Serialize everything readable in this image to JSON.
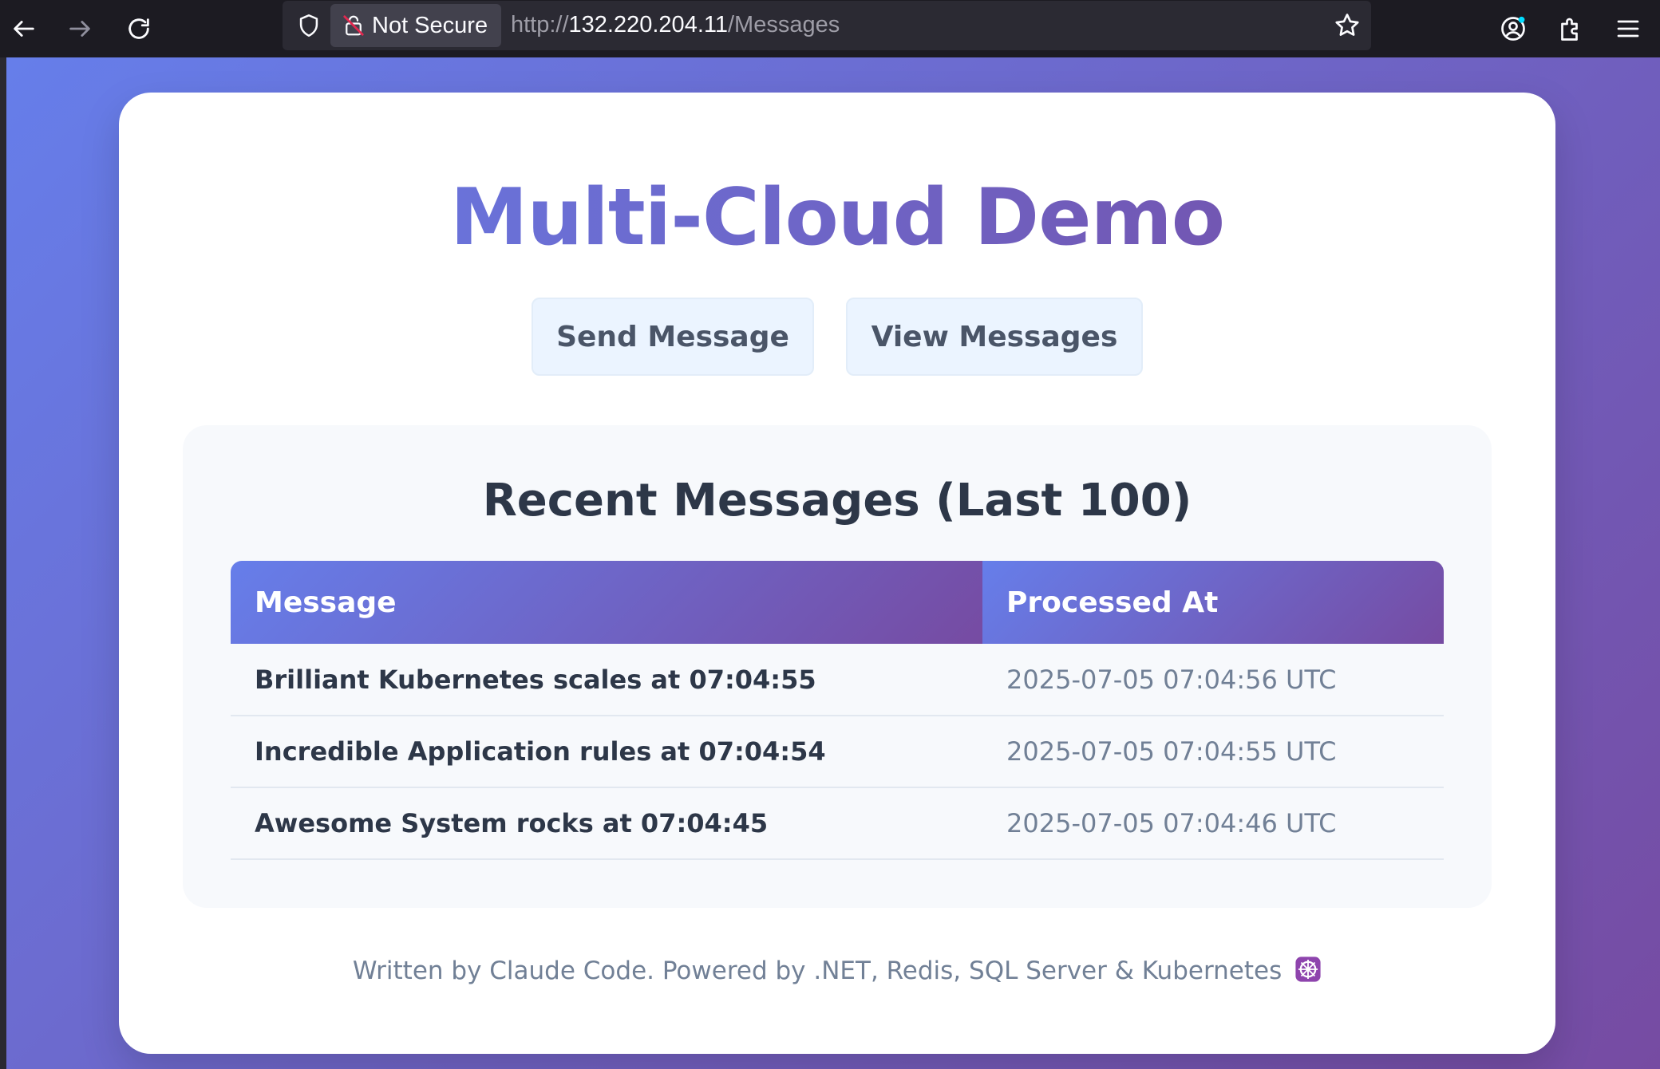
{
  "browser": {
    "security_label": "Not Secure",
    "url_scheme": "http://",
    "url_host": "132.220.204.11",
    "url_path": "/Messages"
  },
  "page": {
    "title": "Multi-Cloud Demo",
    "buttons": {
      "send": "Send Message",
      "view": "View Messages"
    },
    "messages_panel": {
      "title": "Recent Messages (Last 100)",
      "columns": [
        "Message",
        "Processed At"
      ],
      "rows": [
        {
          "message": "Brilliant Kubernetes scales at 07:04:55",
          "processed_at": "2025-07-05 07:04:56 UTC"
        },
        {
          "message": "Incredible Application rules at 07:04:54",
          "processed_at": "2025-07-05 07:04:55 UTC"
        },
        {
          "message": "Awesome System rocks at 07:04:45",
          "processed_at": "2025-07-05 07:04:46 UTC"
        }
      ]
    },
    "footer": "Written by Claude Code. Powered by .NET, Redis, SQL Server & Kubernetes"
  },
  "colors": {
    "gradient_start": "#667eea",
    "gradient_end": "#764ba2",
    "button_bg": "#ebf4ff",
    "text_dark": "#2d3748",
    "text_muted": "#718096"
  },
  "icons": [
    "back-arrow-icon",
    "forward-arrow-icon",
    "reload-icon",
    "shield-icon",
    "lock-insecure-icon",
    "bookmark-star-icon",
    "account-icon",
    "extensions-icon",
    "menu-icon",
    "kubernetes-helm-icon"
  ]
}
